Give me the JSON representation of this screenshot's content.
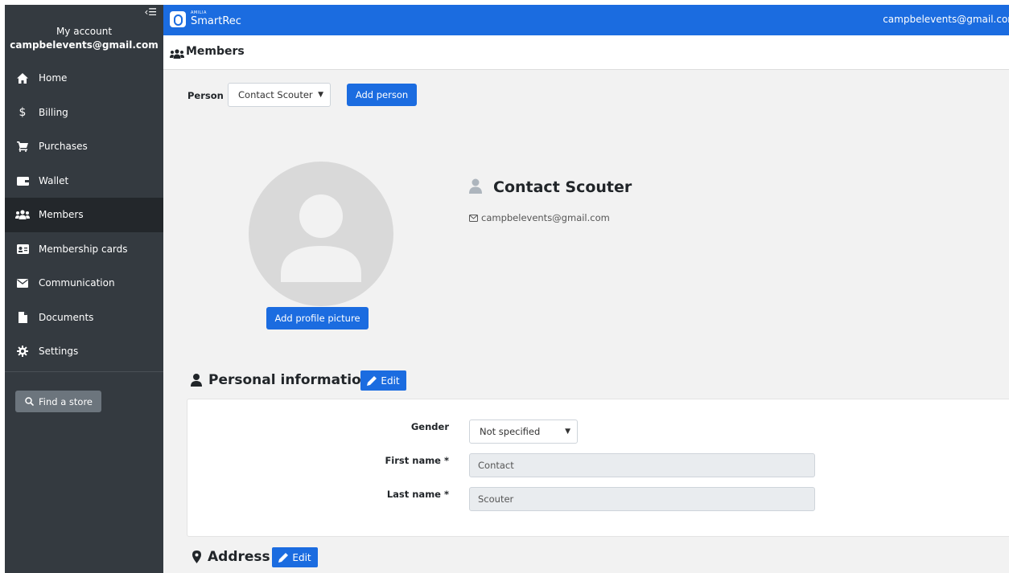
{
  "sidebar": {
    "account_title": "My account",
    "account_email": "campbelevents@gmail.com",
    "items": [
      {
        "label": "Home",
        "icon": "home-icon"
      },
      {
        "label": "Billing",
        "icon": "dollar-icon"
      },
      {
        "label": "Purchases",
        "icon": "cart-icon"
      },
      {
        "label": "Wallet",
        "icon": "wallet-icon"
      },
      {
        "label": "Members",
        "icon": "users-icon",
        "active": true
      },
      {
        "label": "Membership cards",
        "icon": "id-card-icon"
      },
      {
        "label": "Communication",
        "icon": "envelope-icon"
      },
      {
        "label": "Documents",
        "icon": "file-icon"
      },
      {
        "label": "Settings",
        "icon": "gear-icon"
      }
    ],
    "find_store_label": "Find a store"
  },
  "topbar": {
    "brand_small": "AMILIA",
    "brand": "SmartRec",
    "user": "campbelevents@gmail.com"
  },
  "page": {
    "title": "Members"
  },
  "person_select": {
    "label": "Person",
    "value": "Contact Scouter"
  },
  "add_person_label": "Add person",
  "profile": {
    "name": "Contact Scouter",
    "email": "campbelevents@gmail.com",
    "add_picture_label": "Add profile picture"
  },
  "personal_info": {
    "title": "Personal information",
    "edit_label": "Edit",
    "gender_label": "Gender",
    "gender_value": "Not specified",
    "first_name_label": "First name *",
    "first_name_value": "Contact",
    "last_name_label": "Last name *",
    "last_name_value": "Scouter"
  },
  "address": {
    "title": "Address",
    "edit_label": "Edit"
  },
  "colors": {
    "primary": "#1b6ce0",
    "sidebar": "#343a40",
    "sidebar_active": "#23272b"
  }
}
